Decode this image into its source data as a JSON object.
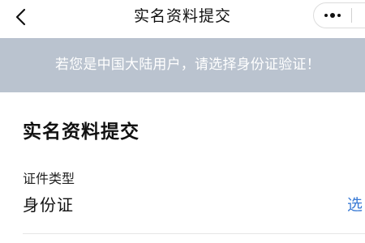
{
  "nav": {
    "title": "实名资料提交",
    "back_icon": "chevron-left-icon",
    "more_icon": "more-dots-icon"
  },
  "banner": {
    "text": "若您是中国大陆用户，请选择身份证验证！",
    "background_color": "#bac3cf"
  },
  "main": {
    "section_title": "实名资料提交",
    "document_type": {
      "label": "证件类型",
      "value": "身份证",
      "select_label": "选"
    }
  },
  "colors": {
    "link": "#3a7bd5"
  }
}
